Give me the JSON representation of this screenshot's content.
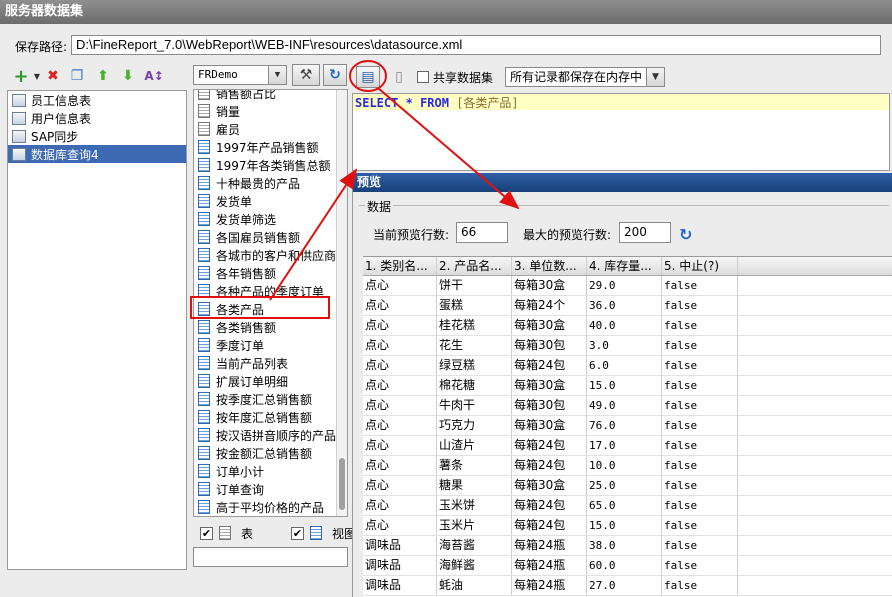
{
  "window": {
    "title": "服务器数据集"
  },
  "path": {
    "label": "保存路径:",
    "value": "D:\\FineReport_7.0\\WebReport\\WEB-INF\\resources\\datasource.xml"
  },
  "datasets": [
    {
      "label": "员工信息表"
    },
    {
      "label": "用户信息表"
    },
    {
      "label": "SAP同步"
    },
    {
      "label": "数据库查询4",
      "selected": true
    }
  ],
  "connection": {
    "selected": "FRDemo"
  },
  "tables": [
    {
      "label": "销售额占比",
      "kind": "table"
    },
    {
      "label": "销量",
      "kind": "table"
    },
    {
      "label": "雇员",
      "kind": "table"
    },
    {
      "label": "1997年产品销售额",
      "kind": "view"
    },
    {
      "label": "1997年各类销售总额",
      "kind": "view"
    },
    {
      "label": "十种最贵的产品",
      "kind": "view"
    },
    {
      "label": "发货单",
      "kind": "view"
    },
    {
      "label": "发货单筛选",
      "kind": "view"
    },
    {
      "label": "各国雇员销售额",
      "kind": "view"
    },
    {
      "label": "各城市的客户和供应商",
      "kind": "view"
    },
    {
      "label": "各年销售额",
      "kind": "view"
    },
    {
      "label": "各种产品的季度订单",
      "kind": "view"
    },
    {
      "label": "各类产品",
      "kind": "view",
      "highlighted": true
    },
    {
      "label": "各类销售额",
      "kind": "view"
    },
    {
      "label": "季度订单",
      "kind": "view"
    },
    {
      "label": "当前产品列表",
      "kind": "view"
    },
    {
      "label": "扩展订单明细",
      "kind": "view"
    },
    {
      "label": "按季度汇总销售额",
      "kind": "view"
    },
    {
      "label": "按年度汇总销售额",
      "kind": "view"
    },
    {
      "label": "按汉语拼音顺序的产品:",
      "kind": "view"
    },
    {
      "label": "按金额汇总销售额",
      "kind": "view"
    },
    {
      "label": "订单小计",
      "kind": "view"
    },
    {
      "label": "订单查询",
      "kind": "view"
    },
    {
      "label": "高于平均价格的产品",
      "kind": "view"
    }
  ],
  "filters": {
    "table_label": "表",
    "view_label": "视图"
  },
  "toolbar": {
    "share_label": "共享数据集",
    "storage_option": "所有记录都保存在内存中"
  },
  "sql": {
    "select": "SELECT",
    "star": "*",
    "from": "FROM",
    "table": "[各类产品]"
  },
  "preview": {
    "title": "预览",
    "group_label": "数据",
    "current_rows_label": "当前预览行数:",
    "current_rows": "66",
    "max_rows_label": "最大的预览行数:",
    "max_rows": "200",
    "columns": [
      "1. 类别名...",
      "2. 产品名...",
      "3. 单位数...",
      "4. 库存量...",
      "5. 中止(?)"
    ],
    "rows": [
      [
        "点心",
        "饼干",
        "每箱30盒",
        "29.0",
        "false"
      ],
      [
        "点心",
        "蛋糕",
        "每箱24个",
        "36.0",
        "false"
      ],
      [
        "点心",
        "桂花糕",
        "每箱30盒",
        "40.0",
        "false"
      ],
      [
        "点心",
        "花生",
        "每箱30包",
        "3.0",
        "false"
      ],
      [
        "点心",
        "绿豆糕",
        "每箱24包",
        "6.0",
        "false"
      ],
      [
        "点心",
        "棉花糖",
        "每箱30盒",
        "15.0",
        "false"
      ],
      [
        "点心",
        "牛肉干",
        "每箱30包",
        "49.0",
        "false"
      ],
      [
        "点心",
        "巧克力",
        "每箱30盒",
        "76.0",
        "false"
      ],
      [
        "点心",
        "山渣片",
        "每箱24包",
        "17.0",
        "false"
      ],
      [
        "点心",
        "薯条",
        "每箱24包",
        "10.0",
        "false"
      ],
      [
        "点心",
        "糖果",
        "每箱30盒",
        "25.0",
        "false"
      ],
      [
        "点心",
        "玉米饼",
        "每箱24包",
        "65.0",
        "false"
      ],
      [
        "点心",
        "玉米片",
        "每箱24包",
        "15.0",
        "false"
      ],
      [
        "调味品",
        "海苔酱",
        "每箱24瓶",
        "38.0",
        "false"
      ],
      [
        "调味品",
        "海鲜酱",
        "每箱24瓶",
        "60.0",
        "false"
      ],
      [
        "调味品",
        "蚝油",
        "每箱24瓶",
        "27.0",
        "false"
      ]
    ]
  }
}
